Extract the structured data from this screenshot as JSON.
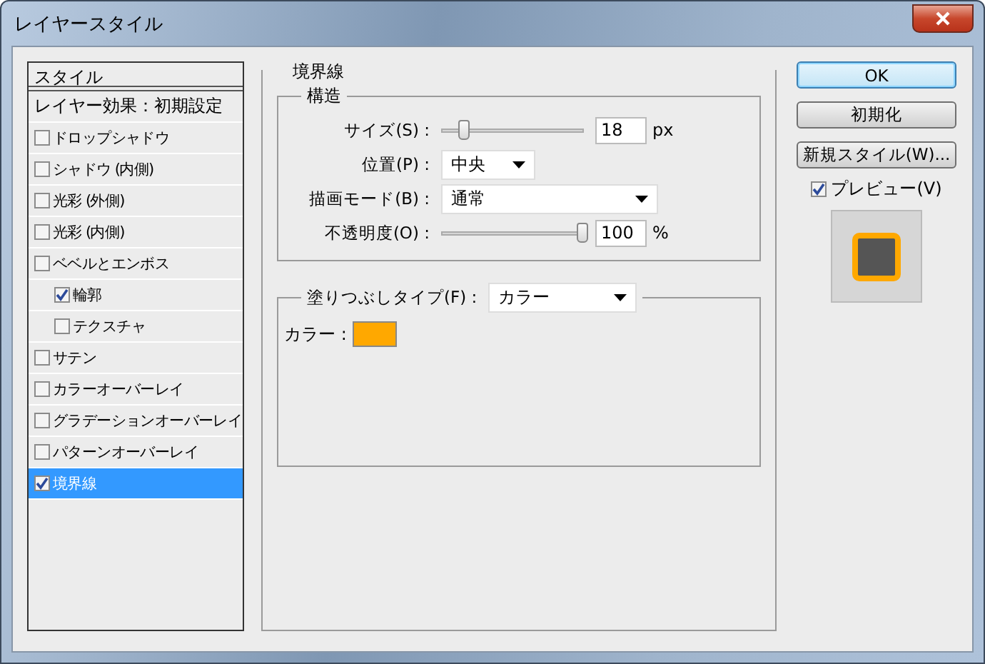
{
  "window": {
    "title": "レイヤースタイル"
  },
  "sidebar": {
    "header": "スタイル",
    "blending_options": "レイヤー効果：初期設定",
    "items": [
      {
        "label": "ドロップシャドウ",
        "checked": false,
        "selected": false
      },
      {
        "label": "シャドウ (内側)",
        "checked": false,
        "selected": false
      },
      {
        "label": "光彩 (外側)",
        "checked": false,
        "selected": false
      },
      {
        "label": "光彩 (内側)",
        "checked": false,
        "selected": false
      },
      {
        "label": "ベベルとエンボス",
        "checked": false,
        "selected": false,
        "children": [
          {
            "label": "輪郭",
            "checked": true,
            "selected": false
          },
          {
            "label": "テクスチャ",
            "checked": false,
            "selected": false
          }
        ]
      },
      {
        "label": "サテン",
        "checked": false,
        "selected": false
      },
      {
        "label": "カラーオーバーレイ",
        "checked": false,
        "selected": false
      },
      {
        "label": "グラデーションオーバーレイ",
        "checked": false,
        "selected": false
      },
      {
        "label": "パターンオーバーレイ",
        "checked": false,
        "selected": false
      },
      {
        "label": "境界線",
        "checked": true,
        "selected": true
      }
    ]
  },
  "stroke": {
    "title": "境界線",
    "structure": {
      "title": "構造",
      "rows": [
        {
          "kind": "slider",
          "label": "サイズ(S) :",
          "level": 0.15,
          "value": "18",
          "unit": "px"
        },
        {
          "kind": "select",
          "label": "位置(P) :",
          "value": "中央"
        },
        {
          "kind": "select",
          "label": "描画モード(B) :",
          "value": "通常"
        },
        {
          "kind": "slider",
          "label": "不透明度(O) :",
          "level": 1,
          "value": "100",
          "unit": "%"
        }
      ]
    },
    "fill": {
      "label": "塗りつぶしタイプ(F) :",
      "value": "カラー",
      "color_label": "カラー :",
      "color": "#ffa800"
    }
  },
  "buttons": [
    {
      "label": "OK",
      "default": true
    },
    {
      "label": "初期化",
      "default": false
    },
    {
      "label": "新規スタイル(W)...",
      "default": false
    }
  ],
  "preview": {
    "label": "プレビュー(V)",
    "checked": true
  }
}
